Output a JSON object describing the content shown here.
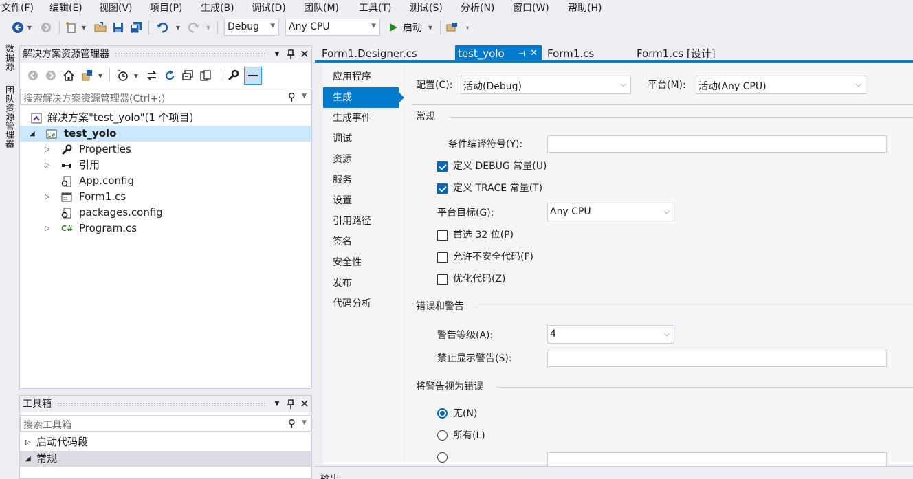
{
  "menus": [
    "文件(F)",
    "编辑(E)",
    "视图(V)",
    "项目(P)",
    "生成(B)",
    "调试(D)",
    "团队(M)",
    "工具(T)",
    "测试(S)",
    "分析(N)",
    "窗口(W)",
    "帮助(H)"
  ],
  "toolbar": {
    "config_value": "Debug",
    "platform_value": "Any CPU",
    "start_label": "启动"
  },
  "left_strip": [
    "数据源",
    "团队资源管理器"
  ],
  "solution_explorer": {
    "title": "解决方案资源管理器",
    "search_placeholder": "搜索解决方案资源管理器(Ctrl+;)",
    "tree": [
      {
        "label": "解决方案\"test_yolo\"(1 个项目)",
        "icon": "solution-icon"
      },
      {
        "label": "test_yolo",
        "icon": "csharp-project-icon"
      },
      {
        "label": "Properties",
        "icon": "wrench-icon"
      },
      {
        "label": "引用",
        "icon": "references-icon"
      },
      {
        "label": "App.config",
        "icon": "config-file-icon"
      },
      {
        "label": "Form1.cs",
        "icon": "form-icon"
      },
      {
        "label": "packages.config",
        "icon": "config-file-icon"
      },
      {
        "label": "Program.cs",
        "icon": "csharp-file-icon"
      }
    ]
  },
  "toolbox": {
    "title": "工具箱",
    "search_placeholder": "搜索工具箱",
    "groups": [
      {
        "label": "启动代码段"
      },
      {
        "label": "常规"
      }
    ]
  },
  "editor_tabs": [
    {
      "label": "Form1.Designer.cs"
    },
    {
      "label": "test_yolo"
    },
    {
      "label": "Form1.cs"
    },
    {
      "label": "Form1.cs [设计]"
    }
  ],
  "nav_items": [
    "应用程序",
    "生成",
    "生成事件",
    "调试",
    "资源",
    "服务",
    "设置",
    "引用路径",
    "签名",
    "安全性",
    "发布",
    "代码分析"
  ],
  "build_page": {
    "config_label": "配置(C):",
    "config_value": "活动(Debug)",
    "platform_label": "平台(M):",
    "platform_value": "活动(Any CPU)",
    "general_title": "常规",
    "conditional_symbols_label": "条件编译符号(Y):",
    "conditional_symbols_value": "",
    "define_debug_label": "定义 DEBUG 常量(U)",
    "define_debug_checked": true,
    "define_trace_label": "定义 TRACE 常量(T)",
    "define_trace_checked": true,
    "platform_target_label": "平台目标(G):",
    "platform_target_value": "Any CPU",
    "prefer32_label": "首选 32 位(P)",
    "prefer32_checked": false,
    "unsafe_label": "允许不安全代码(F)",
    "unsafe_checked": false,
    "optimize_label": "优化代码(Z)",
    "optimize_checked": false,
    "errors_title": "错误和警告",
    "warning_level_label": "警告等级(A):",
    "warning_level_value": "4",
    "suppress_label": "禁止显示警告(S):",
    "suppress_value": "",
    "treat_title": "将警告视为错误",
    "treat_none_label": "无(N)",
    "treat_all_label": "所有(L)",
    "selected_treat_option": "无(N)"
  },
  "output_panel_label": "输出",
  "colors": {
    "accent": "#007acc",
    "chrome": "#eeeef2",
    "selection": "#cce8ff"
  }
}
